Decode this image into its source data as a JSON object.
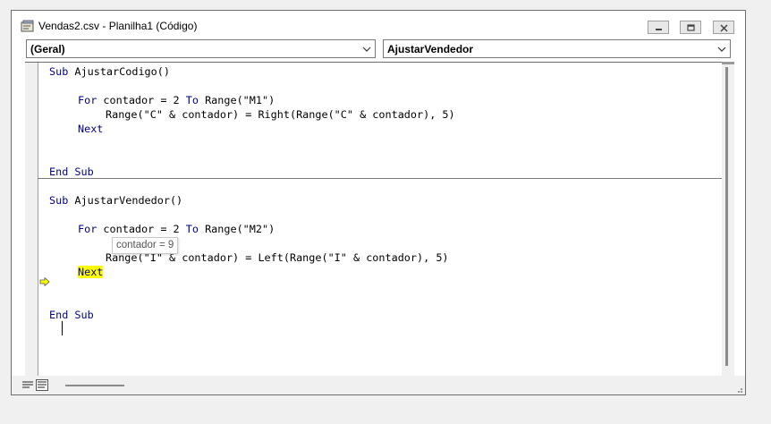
{
  "window": {
    "title": "Vendas2.csv - Planilha1 (Código)"
  },
  "combos": {
    "object": "(Geral)",
    "procedure": "AjustarVendedor"
  },
  "code": {
    "sub1_header_kw": "Sub",
    "sub1_header_name": " AjustarCodigo()",
    "sub1_for_kw": "For",
    "sub1_for_mid": " contador = 2 ",
    "sub1_to_kw": "To",
    "sub1_for_end": " Range(\"M1\")",
    "sub1_body": "Range(\"C\" & contador) = Right(Range(\"C\" & contador), 5)",
    "sub1_next": "Next",
    "sub1_end": "End Sub",
    "sub2_header_kw": "Sub",
    "sub2_header_name": " AjustarVendedor()",
    "sub2_for_kw": "For",
    "sub2_for_mid": " contador = 2 ",
    "sub2_to_kw": "To",
    "sub2_for_end": " Range(\"M2\")",
    "sub2_body": "Range(\"I\" & contador) = Left(Range(\"I\" & contador), 5)",
    "sub2_next": "Next",
    "sub2_end": "End Sub"
  },
  "tooltip": "contador = 9",
  "colors": {
    "keyword": "#00008b",
    "highlight": "#ffff00",
    "exec_arrow": "#ffff00"
  },
  "icons": {
    "exec": "execution-arrow-icon",
    "procedure_view": "procedure-view-icon",
    "full_module_view": "full-module-view-icon"
  }
}
